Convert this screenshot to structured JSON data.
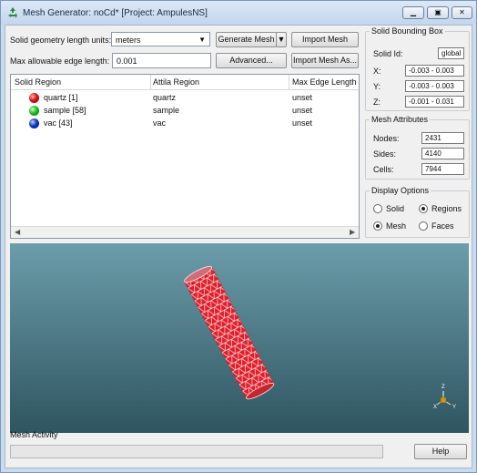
{
  "window": {
    "title": "Mesh Generator: noCd* [Project: AmpulesNS]",
    "controls": [
      "minimize-icon",
      "restore-icon",
      "close-icon"
    ]
  },
  "form": {
    "units_label": "Solid geometry length units:",
    "units_value": "meters",
    "edge_label": "Max allowable edge length:",
    "edge_value": "0.001",
    "generate_mesh_label": "Generate Mesh",
    "advanced_label": "Advanced...",
    "import_mesh_label": "Import Mesh",
    "import_mesh_as_label": "Import Mesh As..."
  },
  "regions_table": {
    "headers": [
      "Solid Region",
      "Attila Region",
      "Max Edge Length"
    ],
    "rows": [
      {
        "name": "quartz [1]",
        "attila": "quartz",
        "max": "unset",
        "color": "#dd1111"
      },
      {
        "name": "sample [58]",
        "attila": "sample",
        "max": "unset",
        "color": "#22bb22"
      },
      {
        "name": "vac [43]",
        "attila": "vac",
        "max": "unset",
        "color": "#1133cc"
      }
    ]
  },
  "bounding_box": {
    "title": "Solid Bounding Box",
    "solid_id_label": "Solid Id:",
    "solid_id_value": "global",
    "x_label": "X:",
    "x_value": "-0.003 - 0.003",
    "y_label": "Y:",
    "y_value": "-0.003 - 0.003",
    "z_label": "Z:",
    "z_value": "-0.001 - 0.031"
  },
  "mesh_attributes": {
    "title": "Mesh Attributes",
    "nodes_label": "Nodes:",
    "nodes_value": "2431",
    "sides_label": "Sides:",
    "sides_value": "4140",
    "cells_label": "Cells:",
    "cells_value": "7944"
  },
  "display_options": {
    "title": "Display Options",
    "solid_label": "Solid",
    "mesh_label": "Mesh",
    "regions_label": "Regions",
    "faces_label": "Faces",
    "geometry_mode": "Mesh",
    "color_mode": "Regions"
  },
  "viewport": {
    "bg_top": "#6c9dab",
    "bg_bottom": "#2e5560",
    "mesh_color": "#e01f2b",
    "axes": [
      "Z",
      "Y",
      "X"
    ]
  },
  "footer": {
    "activity_label": "Mesh Activity",
    "help_label": "Help",
    "progress": 0
  }
}
